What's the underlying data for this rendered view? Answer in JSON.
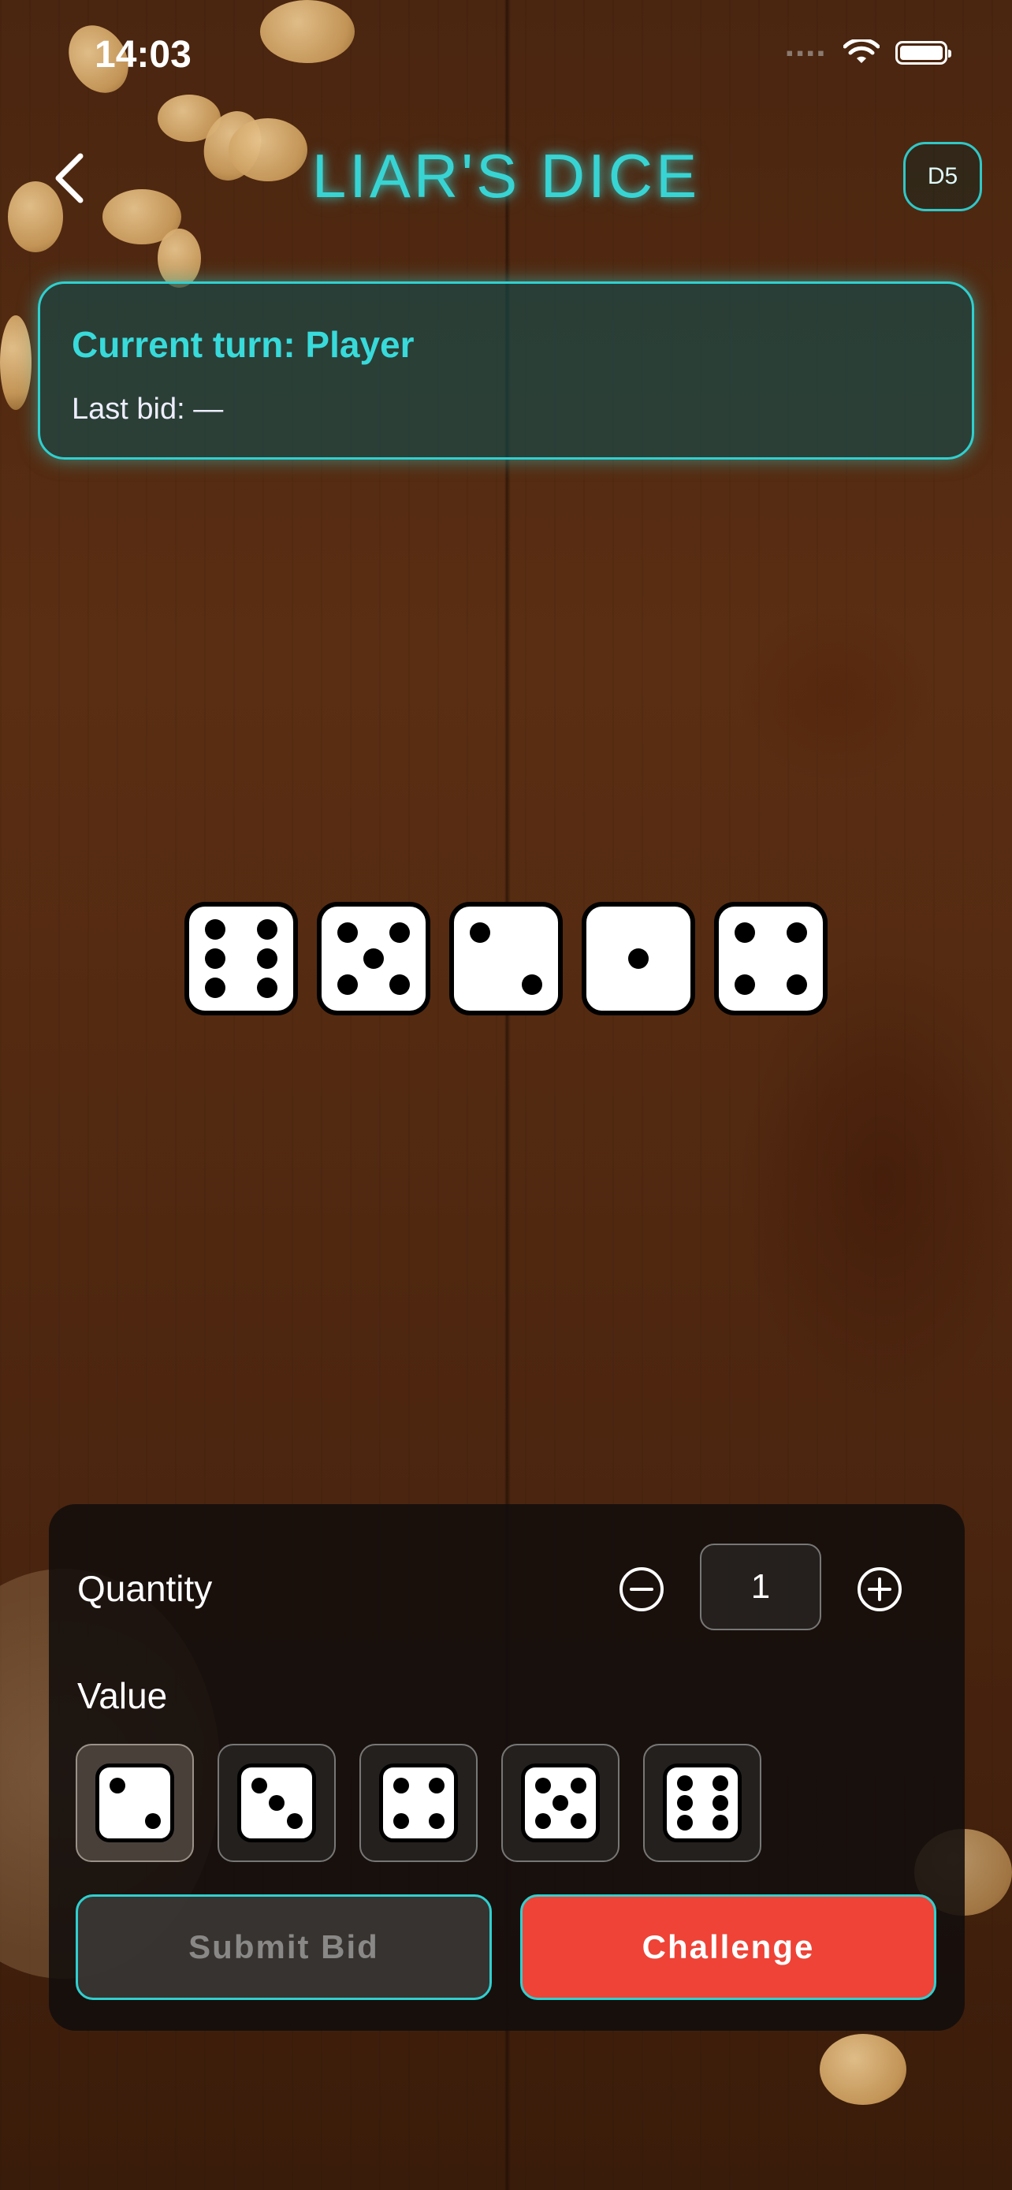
{
  "status_bar": {
    "time": "14:03",
    "icons": [
      "signal-icon",
      "wifi-icon",
      "battery-icon"
    ]
  },
  "header": {
    "back_icon": "chevron-left-icon",
    "title": "LIAR'S DICE",
    "badge": "D5"
  },
  "turn_panel": {
    "current_turn": "Current turn: Player",
    "last_bid": "Last bid: —"
  },
  "player_dice": [
    6,
    5,
    2,
    1,
    4
  ],
  "bid_controls": {
    "quantity_label": "Quantity",
    "quantity_value": "1",
    "minus_icon": "minus-circle-icon",
    "plus_icon": "plus-circle-icon",
    "value_label": "Value",
    "value_options": [
      2,
      3,
      4,
      5,
      6
    ],
    "selected_value": 2
  },
  "actions": {
    "submit_label": "Submit Bid",
    "challenge_label": "Challenge"
  },
  "colors": {
    "accent_cyan": "#2fd0d0",
    "challenge_red": "#ee4336",
    "panel_bg": "#0a5055"
  }
}
